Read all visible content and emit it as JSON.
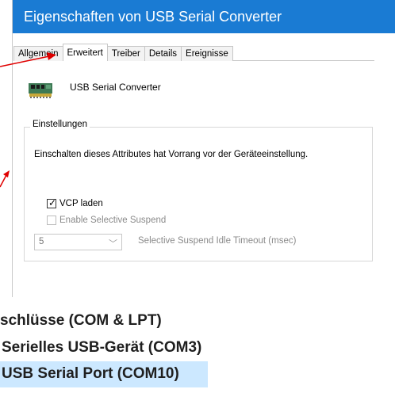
{
  "dialog": {
    "title": "Eigenschaften von USB Serial Converter",
    "tabs": [
      "Allgemein",
      "Erweitert",
      "Treiber",
      "Details",
      "Ereignisse"
    ],
    "active_tab": "Erweitert",
    "device_name": "USB Serial Converter",
    "group_title": "Einstellungen",
    "description": "Einschalten dieses Attributes hat Vorrang vor der Geräteeinstellung.",
    "vcp_label": "VCP laden",
    "vcp_checked": true,
    "suspend_label": "Enable Selective Suspend",
    "suspend_checked": false,
    "timeout_value": "5",
    "timeout_label": "Selective Suspend Idle Timeout (msec)"
  },
  "device_list": {
    "items": [
      "schlüsse (COM & LPT)",
      "Serielles USB-Gerät (COM3)",
      "USB Serial Port (COM10)"
    ],
    "selected_index": 2
  },
  "colors": {
    "titlebar": "#1a7bd3",
    "annotation": "#e00000",
    "selection": "#cce8ff"
  },
  "icons": {
    "device": "network-card-icon",
    "dropdown": "chevron-down-icon"
  }
}
